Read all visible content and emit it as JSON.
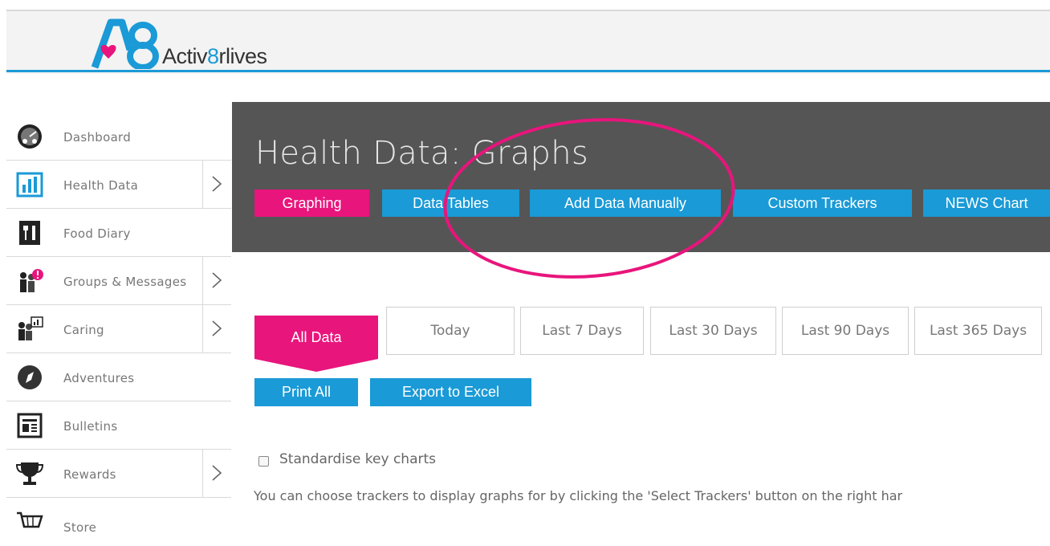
{
  "brand": {
    "logo_mark": "A8",
    "name_pre": "Activ",
    "name_eight": "8",
    "name_post": "rlives"
  },
  "sidebar": {
    "items": [
      {
        "label": "Dashboard",
        "icon": "speedometer-icon",
        "has_arrow": false
      },
      {
        "label": "Health Data",
        "icon": "bar-chart-icon",
        "has_arrow": true
      },
      {
        "label": "Food Diary",
        "icon": "fork-knife-icon",
        "has_arrow": false
      },
      {
        "label": "Groups & Messages",
        "icon": "people-alert-icon",
        "has_arrow": true
      },
      {
        "label": "Caring",
        "icon": "people-chart-icon",
        "has_arrow": true
      },
      {
        "label": "Adventures",
        "icon": "compass-icon",
        "has_arrow": false
      },
      {
        "label": "Bulletins",
        "icon": "newspaper-icon",
        "has_arrow": false
      },
      {
        "label": "Rewards",
        "icon": "trophy-icon",
        "has_arrow": true
      },
      {
        "label": "Store",
        "icon": "cart-icon",
        "has_arrow": false
      }
    ]
  },
  "page": {
    "title": "Health Data: Graphs"
  },
  "tabs": [
    {
      "label": "Graphing",
      "color": "#e8157c",
      "active": true
    },
    {
      "label": "Data Tables",
      "color": "#1a9ad6",
      "active": false
    },
    {
      "label": "Add Data Manually",
      "color": "#1a9ad6",
      "active": false
    },
    {
      "label": "Custom Trackers",
      "color": "#1a9ad6",
      "active": false
    },
    {
      "label": "NEWS Chart",
      "color": "#1a9ad6",
      "active": false
    }
  ],
  "periods": {
    "active": "All Data",
    "options": [
      "Today",
      "Last 7 Days",
      "Last 30 Days",
      "Last 90 Days",
      "Last 365 Days"
    ]
  },
  "actions": {
    "print_all": "Print All",
    "export_excel": "Export to Excel"
  },
  "options": {
    "standardise_label": "Standardise key charts",
    "standardise_checked": false
  },
  "info": "You can choose trackers to display graphs for by clicking the 'Select Trackers' button on the right har",
  "colors": {
    "accent_pink": "#e8157c",
    "accent_blue": "#1a9ad6",
    "banner_bg": "#555555"
  }
}
